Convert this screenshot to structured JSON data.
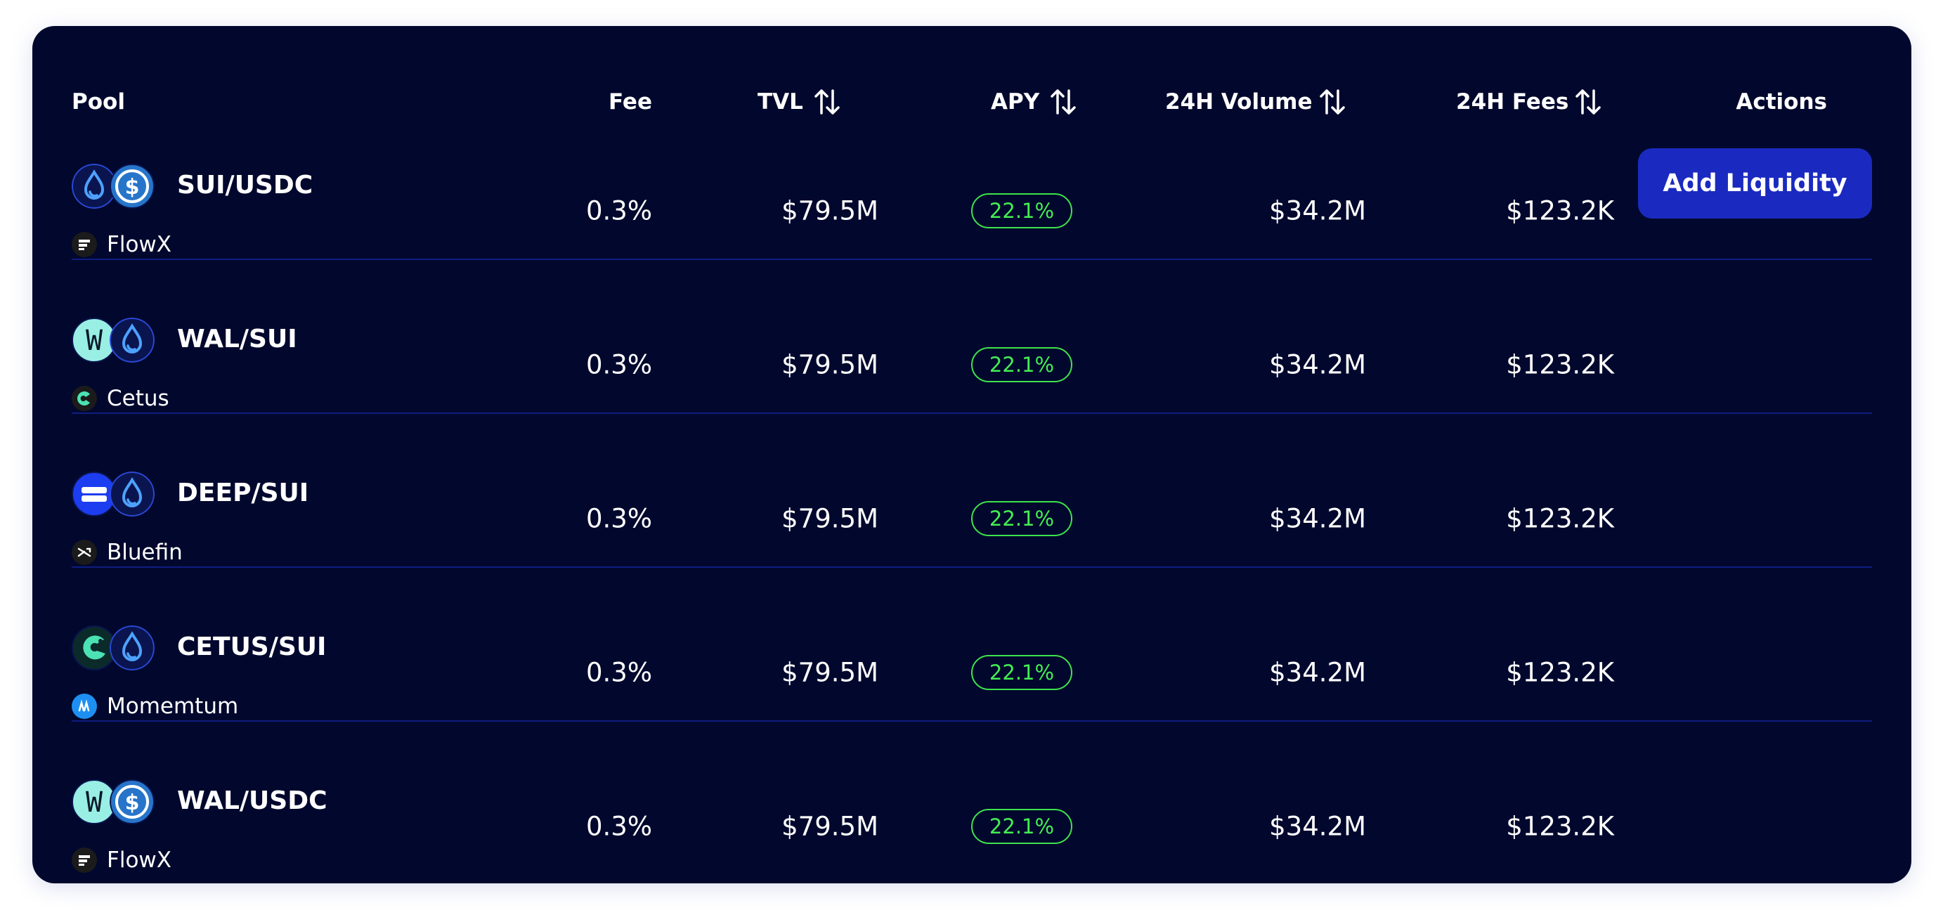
{
  "header": {
    "pool": "Pool",
    "fee": "Fee",
    "tvl": "TVL",
    "apy": "APY",
    "volume": "24H Volume",
    "fees": "24H Fees",
    "actions": "Actions"
  },
  "icons": {
    "sort": "sort-arrows-icon",
    "sui": "sui-droplet-icon",
    "usdc": "usdc-dollar-icon",
    "wal": "walrus-w-icon",
    "deep": "deepbook-icon",
    "cetus": "cetus-icon"
  },
  "colors": {
    "panel": "#02082d",
    "divider": "#0f1d82",
    "apy_green": "#44ee52",
    "button": "#1a2ac0",
    "sui_blue": "#4da2ff",
    "usdc_blue": "#2775ca",
    "wal_mint": "#99efe4"
  },
  "rows": [
    {
      "pair": "SUI/USDC",
      "dex": "FlowX",
      "fee": "0.3%",
      "tvl": "$79.5M",
      "apy": "22.1%",
      "volume": "$34.2M",
      "fees": "$123.2K"
    },
    {
      "pair": "WAL/SUI",
      "dex": "Cetus",
      "fee": "0.3%",
      "tvl": "$79.5M",
      "apy": "22.1%",
      "volume": "$34.2M",
      "fees": "$123.2K"
    },
    {
      "pair": "DEEP/SUI",
      "dex": "Bluefin",
      "fee": "0.3%",
      "tvl": "$79.5M",
      "apy": "22.1%",
      "volume": "$34.2M",
      "fees": "$123.2K"
    },
    {
      "pair": "CETUS/SUI",
      "dex": "Momemtum",
      "fee": "0.3%",
      "tvl": "$79.5M",
      "apy": "22.1%",
      "volume": "$34.2M",
      "fees": "$123.2K"
    },
    {
      "pair": "WAL/USDC",
      "dex": "FlowX",
      "fee": "0.3%",
      "tvl": "$79.5M",
      "apy": "22.1%",
      "volume": "$34.2M",
      "fees": "$123.2K"
    }
  ],
  "actions": {
    "add_liquidity": "Add Liquidity"
  }
}
